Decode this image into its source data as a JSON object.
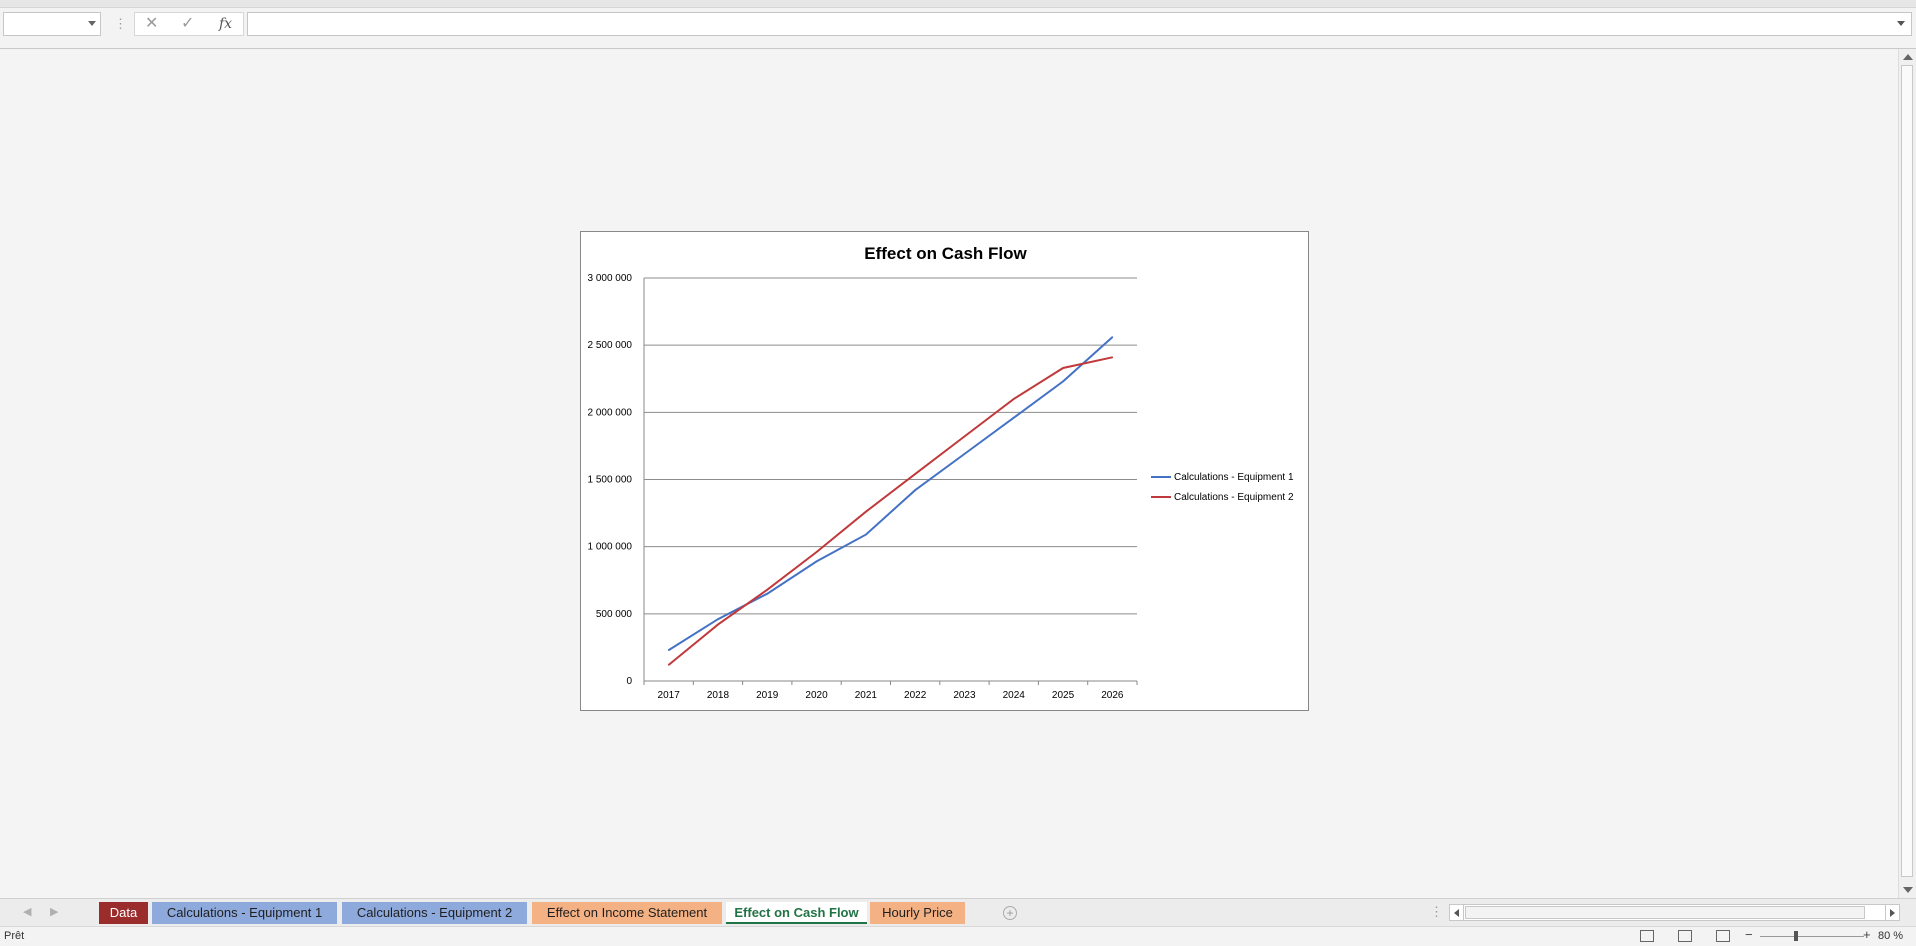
{
  "formula_bar": {
    "name_box_value": "",
    "cancel_icon": "✕",
    "enter_icon": "✓",
    "function_icon": "fx",
    "formula_value": ""
  },
  "chart_data": {
    "type": "line",
    "title": "Effect on Cash Flow",
    "xlabel": "",
    "ylabel": "",
    "categories": [
      "2017",
      "2018",
      "2019",
      "2020",
      "2021",
      "2022",
      "2023",
      "2024",
      "2025",
      "2026"
    ],
    "ylim": [
      0,
      3000000
    ],
    "y_ticks": [
      0,
      500000,
      1000000,
      1500000,
      2000000,
      2500000,
      3000000
    ],
    "y_tick_labels": [
      "0",
      "500 000",
      "1 000 000",
      "1 500 000",
      "2 000 000",
      "2 500 000",
      "3 000 000"
    ],
    "grid": true,
    "legend_position": "right",
    "series": [
      {
        "name": "Calculations - Equipment 1",
        "color": "#4472C4",
        "values": [
          230000,
          460000,
          650000,
          890000,
          1090000,
          1420000,
          1690000,
          1960000,
          2230000,
          2560000
        ]
      },
      {
        "name": "Calculations - Equipment 2",
        "color": "#C0393B",
        "values": [
          120000,
          420000,
          680000,
          960000,
          1260000,
          1540000,
          1820000,
          2100000,
          2330000,
          2410000
        ]
      }
    ]
  },
  "sheet_tabs": [
    {
      "label": "Data",
      "color": "#9B2C2C",
      "text_color": "#ffffff",
      "active": false
    },
    {
      "label": "Calculations - Equipment 1",
      "color": "#8EA9DB",
      "text_color": "#1f1f1f",
      "active": false
    },
    {
      "label": "Calculations - Equipment 2",
      "color": "#8EA9DB",
      "text_color": "#1f1f1f",
      "active": false
    },
    {
      "label": "Effect on Income Statement",
      "color": "#F4B183",
      "text_color": "#1f1f1f",
      "active": false
    },
    {
      "label": "Effect on Cash Flow",
      "color": "#ffffff",
      "text_color": "#217346",
      "active": true
    },
    {
      "label": "Hourly Price",
      "color": "#F4B183",
      "text_color": "#1f1f1f",
      "active": false
    }
  ],
  "status_bar": {
    "status": "Prêt",
    "zoom": "80 %",
    "zoom_minus": "−",
    "zoom_plus": "+"
  }
}
